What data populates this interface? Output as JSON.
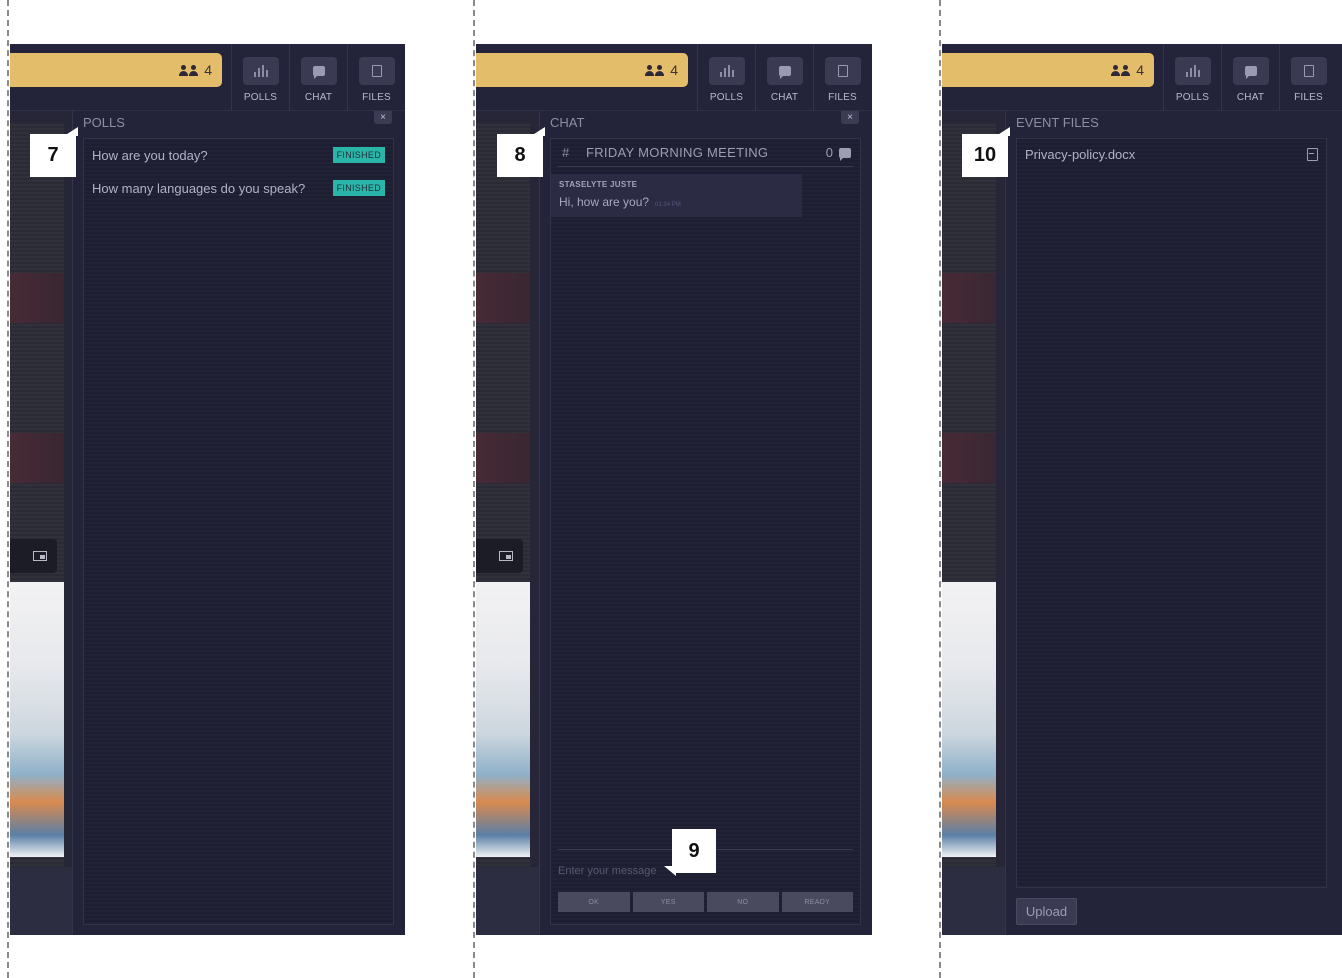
{
  "colors": {
    "accent_gold": "#e3bd6a",
    "finished_badge": "#29b6a8",
    "panel_bg": "#232339"
  },
  "header": {
    "participant_count": "4",
    "tabs": [
      {
        "label": "POLLS",
        "icon": "poll-icon"
      },
      {
        "label": "CHAT",
        "icon": "chat-icon"
      },
      {
        "label": "FILES",
        "icon": "file-icon"
      }
    ]
  },
  "polls_panel": {
    "title": "POLLS",
    "close": "×",
    "callout": "7",
    "items": [
      {
        "question": "How are you today?",
        "status": "FINISHED"
      },
      {
        "question": "How many languages do you speak?",
        "status": "FINISHED"
      }
    ]
  },
  "chat_panel": {
    "title": "CHAT",
    "close": "×",
    "callout": "8",
    "input_callout": "9",
    "channel": {
      "name": "FRIDAY MORNING MEETING",
      "unread": "0"
    },
    "messages": [
      {
        "author": "STASELYTE JUSTE",
        "text": "Hi, how are you?",
        "time": "01:34 PM"
      }
    ],
    "input_placeholder": "Enter your message",
    "quick_replies": [
      "OK",
      "YES",
      "NO",
      "READY"
    ]
  },
  "files_panel": {
    "title": "EVENT FILES",
    "close": "×",
    "callout": "10",
    "files": [
      {
        "name": "Privacy-policy.docx"
      }
    ],
    "upload_label": "Upload"
  }
}
